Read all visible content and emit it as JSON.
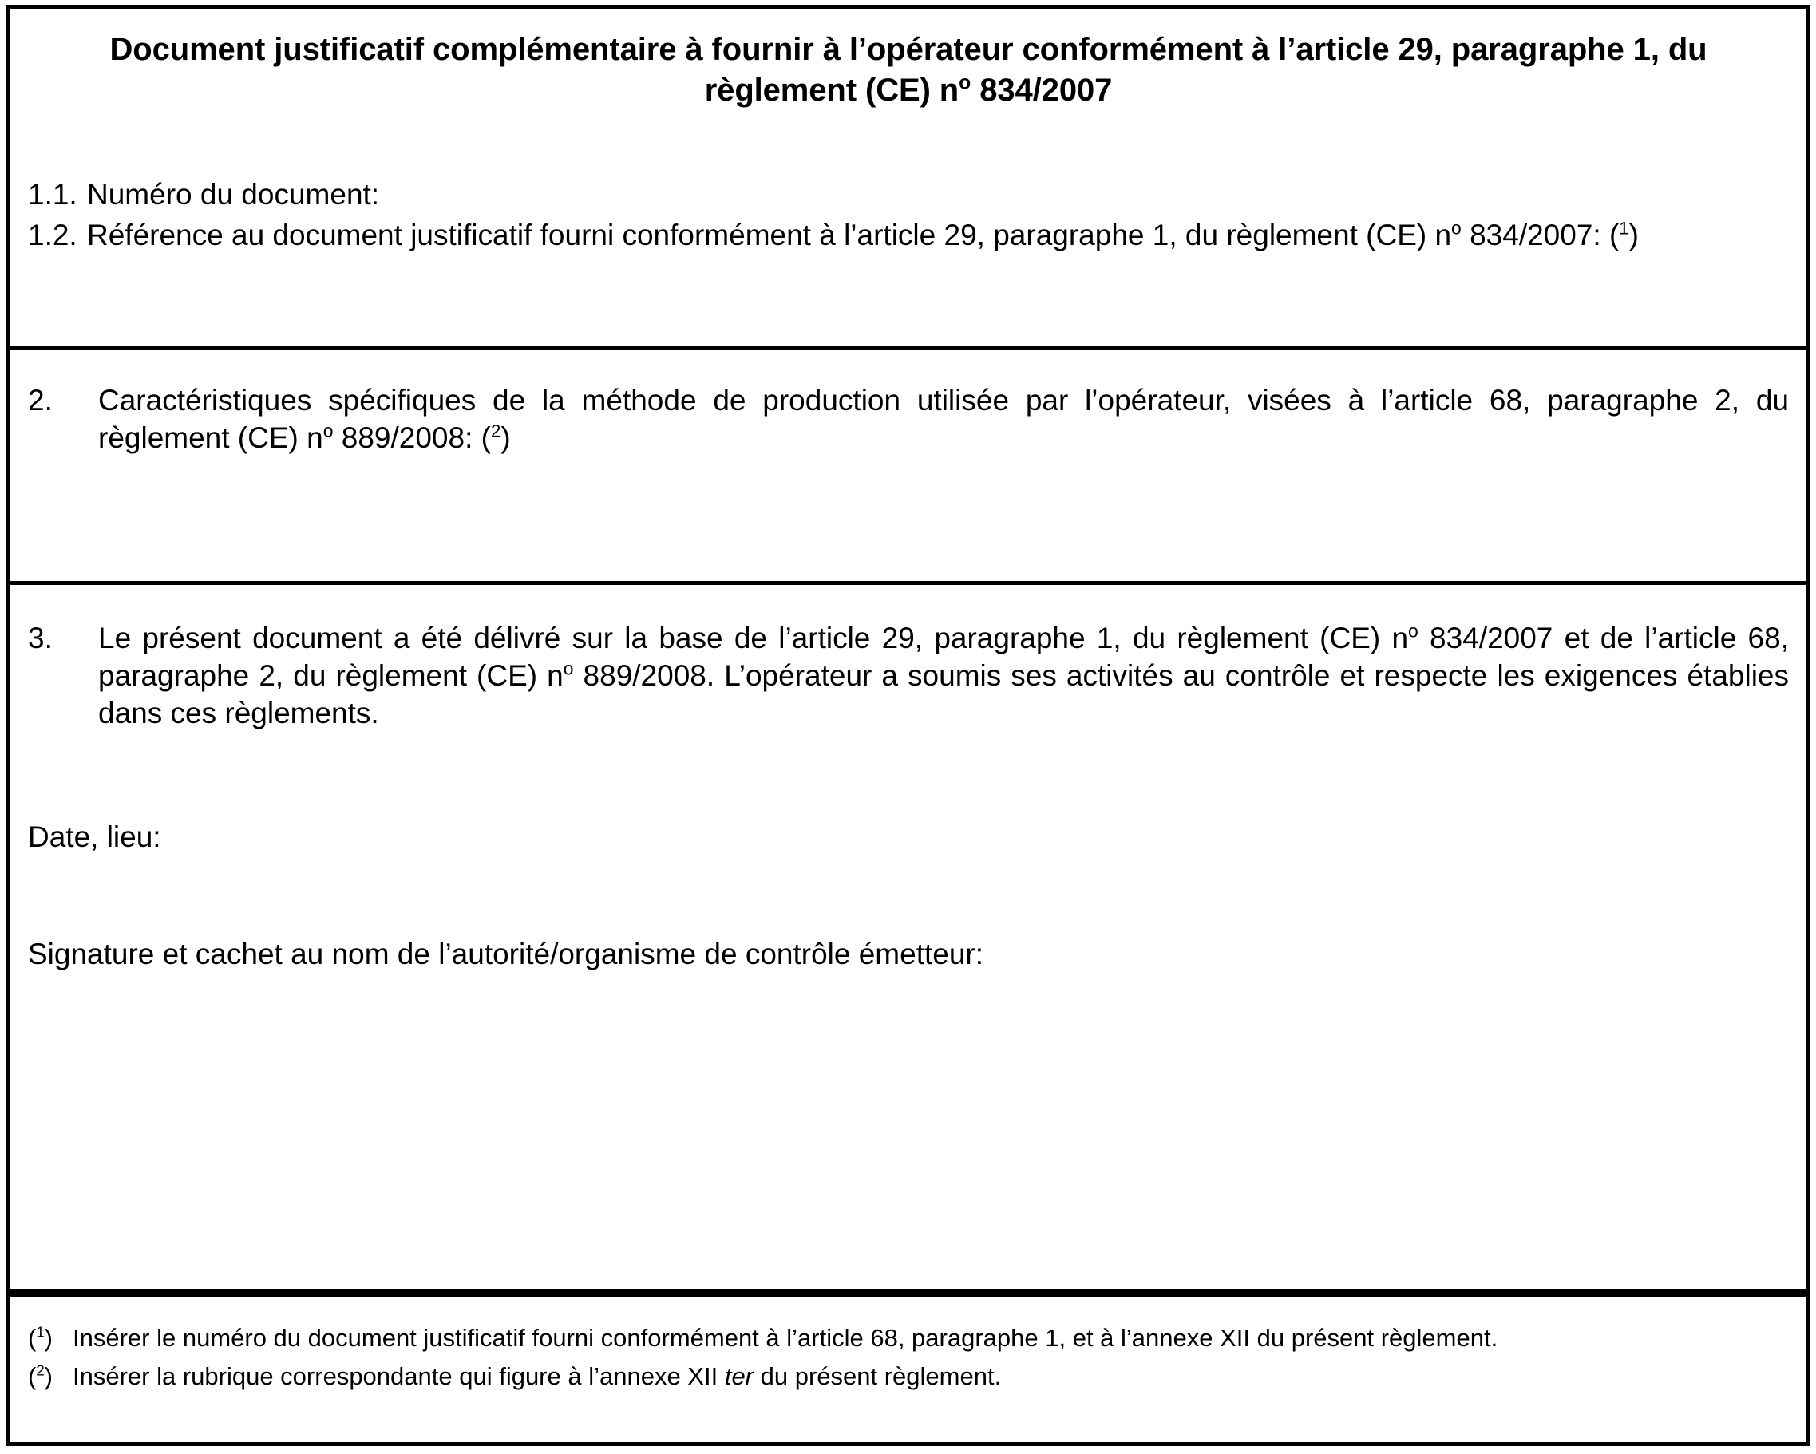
{
  "document": {
    "title_line_1": "Document justificatif complémentaire à fournir à l’opérateur conformément à l’article 29, paragraphe 1, du",
    "title_line_2_pre": "règlement (CE) n",
    "title_line_2_ord": "o",
    "title_line_2_post": " 834/2007"
  },
  "section_1": {
    "item_1_1": {
      "number": "1.1.",
      "text": "Numéro du document:"
    },
    "item_1_2": {
      "number": "1.2.",
      "text_part_1": "Référence au document justificatif fourni conformément à l’article 29, paragraphe 1, du règlement (CE) n",
      "ordinal": "o",
      "text_part_2": " 834/2007: (",
      "footnote_ref": "1",
      "text_part_3": ")"
    }
  },
  "section_2": {
    "number": "2.",
    "text_part_1": "Caractéristiques spécifiques de la méthode de production utilisée par l’opérateur, visées à l’article 68, paragraphe 2, du règlement (CE) n",
    "ordinal": "o",
    "text_part_2": " 889/2008: (",
    "footnote_ref": "2",
    "text_part_3": ")"
  },
  "section_3": {
    "number": "3.",
    "text_part_1": "Le présent document a été délivré sur la base de l’article 29, paragraphe 1, du règlement (CE) n",
    "ordinal_1": "o",
    "text_part_2": " 834/2007 et de l’article 68, paragraphe 2, du règlement (CE) n",
    "ordinal_2": "o",
    "text_part_3": " 889/2008. L’opérateur a soumis ses activités au contrôle et respecte les exigences établies dans ces règlements.",
    "date_label": "Date, lieu:",
    "signature_label": "Signature et cachet au nom de l’autorité/organisme de contrôle émetteur:"
  },
  "footnotes": {
    "note_1": {
      "open_paren": "(",
      "marker": "1",
      "close_paren": ")",
      "text": "Insérer le numéro du document justificatif fourni conformément à l’article 68, paragraphe 1, et à l’annexe XII du présent règlement."
    },
    "note_2": {
      "open_paren": "(",
      "marker": "2",
      "close_paren": ")",
      "text_part_1": "Insérer la rubrique correspondante qui figure à l’annexe XII ",
      "italic_word": "ter",
      "text_part_2": " du présent règlement."
    }
  },
  "colors": {
    "text": "#000000",
    "border": "#000000",
    "background": "#ffffff"
  }
}
